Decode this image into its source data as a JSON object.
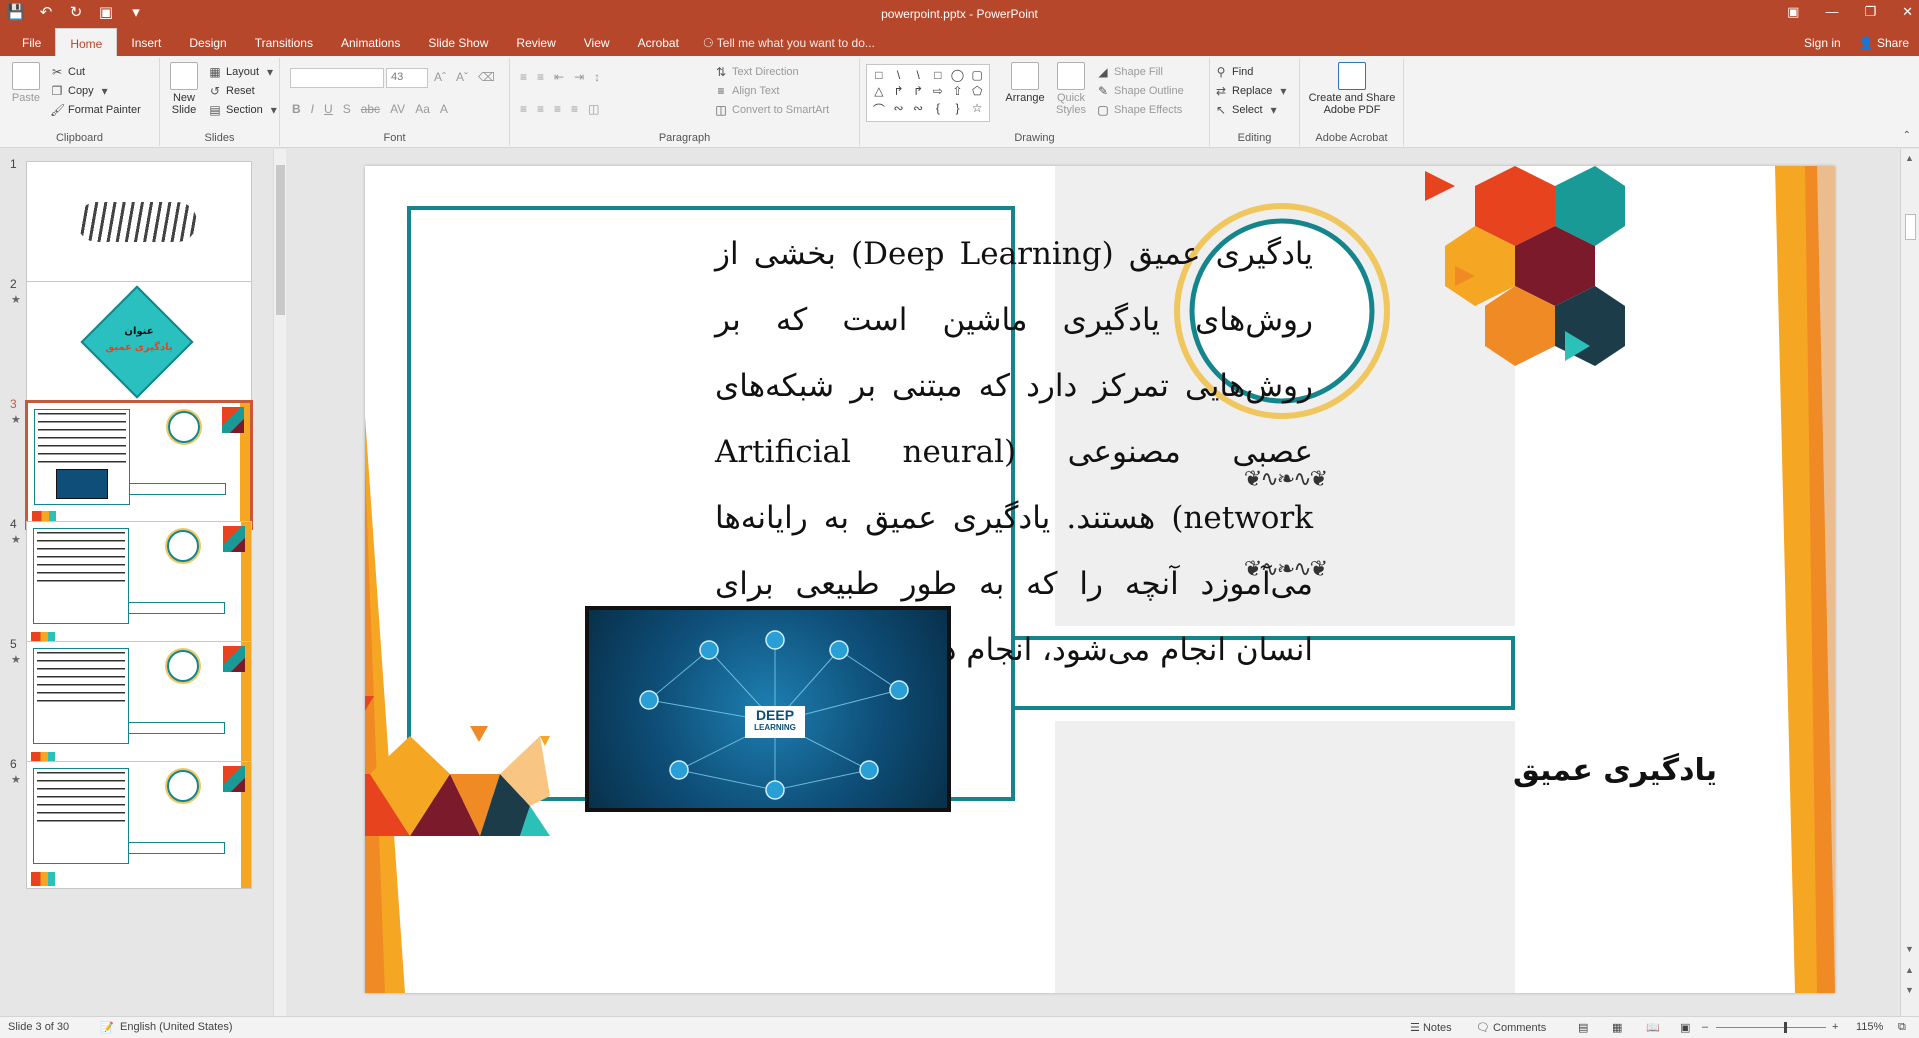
{
  "titlebar": {
    "title": "powerpoint.pptx - PowerPoint",
    "qat": [
      "save-icon",
      "undo-icon",
      "redo-icon",
      "presenter-icon",
      "customize-icon"
    ],
    "window_controls": [
      "ribbon-display-icon",
      "minimize-icon",
      "restore-icon",
      "close-icon"
    ]
  },
  "tabs": [
    "File",
    "Home",
    "Insert",
    "Design",
    "Transitions",
    "Animations",
    "Slide Show",
    "Review",
    "View",
    "Acrobat"
  ],
  "active_tab": "Home",
  "tell_me": "Tell me what you want to do...",
  "sign_in": "Sign in",
  "share": "Share",
  "ribbon": {
    "clipboard": {
      "paste": "Paste",
      "cut": "Cut",
      "copy": "Copy",
      "format_painter": "Format Painter",
      "label": "Clipboard"
    },
    "slides": {
      "new_slide_1": "New",
      "new_slide_2": "Slide",
      "layout": "Layout",
      "reset": "Reset",
      "section": "Section",
      "label": "Slides"
    },
    "font": {
      "font_name": "",
      "font_size": "43",
      "label": "Font"
    },
    "paragraph": {
      "text_direction": "Text Direction",
      "align_text": "Align Text",
      "convert_smartart": "Convert to SmartArt",
      "label": "Paragraph"
    },
    "drawing": {
      "arrange": "Arrange",
      "quick_styles_1": "Quick",
      "quick_styles_2": "Styles",
      "shape_fill": "Shape Fill",
      "shape_outline": "Shape Outline",
      "shape_effects": "Shape Effects",
      "label": "Drawing"
    },
    "editing": {
      "find": "Find",
      "replace": "Replace",
      "select": "Select",
      "label": "Editing"
    },
    "acrobat": {
      "create_1": "Create and Share",
      "create_2": "Adobe PDF",
      "label": "Adobe Acrobat"
    }
  },
  "thumbnails": [
    {
      "num": "1",
      "star": false
    },
    {
      "num": "2",
      "star": true,
      "title": "عنوان",
      "subtitle": "یادگیری عمیق"
    },
    {
      "num": "3",
      "star": true,
      "selected": true
    },
    {
      "num": "4",
      "star": true
    },
    {
      "num": "5",
      "star": true
    },
    {
      "num": "6",
      "star": true
    }
  ],
  "slide": {
    "body": "یادگیری عمیق (Deep Learning) بخشی از روش‌های یادگیری ماشین است که بر روش‌هایی تمرکز دارد که مبتنی بر شبکه‌های عصبی مصنوعی (Artificial neural network) هستند. یادگیری عمیق به رایانه‌ها می‌آموزد آنچه را که به طور طبیعی برای انسان انجام می‌شود، انجام دهند.",
    "image_badge": "DEEP",
    "image_badge_sub": "LEARNING",
    "title": "یادگیری عمیق"
  },
  "status": {
    "slide_info": "Slide 3 of 30",
    "language": "English (United States)",
    "notes": "Notes",
    "comments": "Comments",
    "zoom": "115%"
  },
  "colors": {
    "accent": "#b7472a",
    "teal": "#14858c",
    "gold": "#f0c75e",
    "orange": "#f08a24"
  }
}
